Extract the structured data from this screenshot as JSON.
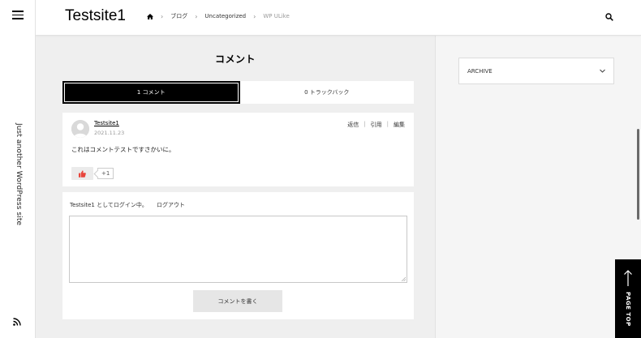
{
  "site": {
    "title": "Testsite1",
    "tagline": "Just another WordPress site"
  },
  "breadcrumb": {
    "home_icon": "home-icon",
    "items": [
      "ブログ",
      "Uncategorized"
    ],
    "current": "WP ULike"
  },
  "comments": {
    "heading": "コメント",
    "tabs": [
      {
        "label": "1 コメント",
        "active": true
      },
      {
        "label": "0 トラックバック",
        "active": false
      }
    ],
    "list": [
      {
        "author": "Testsite1",
        "date": "2021.11.23",
        "actions": [
          "返信",
          "引用",
          "編集"
        ],
        "text": "これはコメントテストですさかいに。",
        "like_icon": "thumbs-up-icon",
        "like_count": "+1"
      }
    ],
    "form": {
      "login_info": "Testsite1 としてログイン中。",
      "logout_label": "ログアウト",
      "textarea_value": "",
      "submit_label": "コメントを書く"
    }
  },
  "sidebar": {
    "archive_label": "ARCHIVE"
  },
  "page_top": {
    "label": "PAGE TOP"
  },
  "colors": {
    "accent": "#000000",
    "like": "#e8453c",
    "background": "#efefef"
  }
}
